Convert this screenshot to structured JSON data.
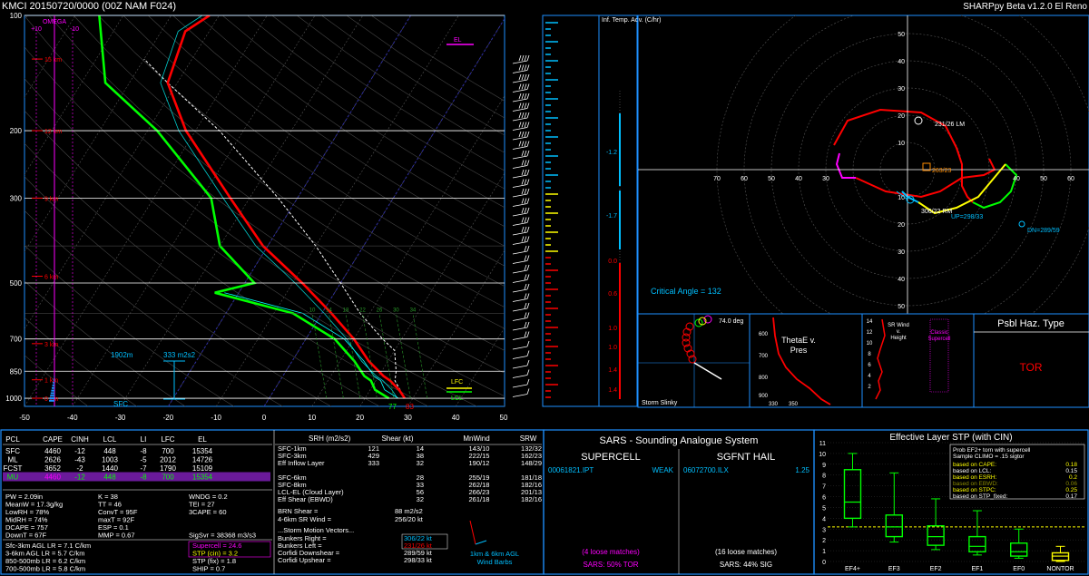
{
  "header": {
    "station_line": "KMCI  20150720/0000  (00Z  NAM  F024)",
    "app_name": "SHARPpy Beta v1.2.0 El Reno"
  },
  "skewt": {
    "pressure_ticks": [
      "100",
      "200",
      "300",
      "500",
      "700",
      "850",
      "1000"
    ],
    "temp_ticks": [
      "-50",
      "-40",
      "-30",
      "-20",
      "-10",
      "0",
      "10",
      "20",
      "30",
      "40",
      "50"
    ],
    "height_labels": [
      "15 km",
      "12 km",
      "9 km",
      "6 km",
      "3 km",
      "1 km",
      "0 km"
    ],
    "omega_label": "OMEGA",
    "omega_ticks": [
      "+10",
      "-10"
    ],
    "el_label": "EL",
    "lfc_label": "LFC",
    "lcl_label": "LCL",
    "sfc_label": "SFC",
    "inflow_depth": "1902m",
    "inflow_srh": "333 m2s2",
    "sfc_td": "77",
    "sfc_t": "83",
    "mixing_ratios": [
      "10",
      "14",
      "18",
      "22",
      "26",
      "30",
      "34"
    ]
  },
  "inferred_temp_adv": {
    "title": "Inf. Temp. Adv. (C/hr)",
    "values": [
      "-1.2",
      "-1.7",
      "0.0",
      "0.6",
      "1.0",
      "1.0",
      "1.4",
      "1.4"
    ]
  },
  "hodograph": {
    "range_labels": [
      "10",
      "20",
      "30",
      "40",
      "50"
    ],
    "x_left_labels": [
      "70",
      "60",
      "50",
      "40",
      "30"
    ],
    "x_right_labels": [
      "40",
      "50",
      "60",
      "70"
    ],
    "bunkers_left": "231/26 LM",
    "bunkers_right": "306/22 RM",
    "mean_wind": "263/23",
    "upshear": "UP=298/33",
    "downshear": "DN=289/59",
    "critical_angle": "Critical Angle = 132"
  },
  "storm_slinky": {
    "title": "Storm Slinky",
    "angle": "74.0 deg"
  },
  "thetae": {
    "title_line1": "ThetaE v.",
    "title_line2": "Pres",
    "p_ticks": [
      "600",
      "700",
      "800",
      "900"
    ],
    "x_ticks": [
      "330",
      "350"
    ]
  },
  "srwind": {
    "title_line1": "SR Wind",
    "title_line2": "v.",
    "title_line3": "Height",
    "annotation_line1": "Classic",
    "annotation_line2": "Supercell",
    "h_ticks": [
      "14",
      "12",
      "10",
      "8",
      "6",
      "4",
      "2"
    ]
  },
  "hazard": {
    "title": "Psbl Haz. Type",
    "value": "TOR"
  },
  "parcels": {
    "headers": [
      "PCL",
      "CAPE",
      "CINH",
      "LCL",
      "LI",
      "LFC",
      "EL"
    ],
    "rows": [
      [
        "SFC",
        "4460",
        "-12",
        "448",
        "-8",
        "700",
        "15354"
      ],
      [
        "ML",
        "2626",
        "-43",
        "1003",
        "-5",
        "2012",
        "14726"
      ],
      [
        "FCST",
        "3652",
        "-2",
        "1440",
        "-7",
        "1790",
        "15109"
      ],
      [
        "MU",
        "4460",
        "-12",
        "448",
        "-8",
        "700",
        "15354"
      ]
    ]
  },
  "thermo": {
    "col1": [
      "PW = 2.09in",
      "MeanW = 17.3g/kg",
      "LowRH = 78%",
      "MidRH = 74%",
      "DCAPE = 757",
      "DownT = 67F"
    ],
    "col2": [
      "K = 38",
      "TT = 46",
      "ConvT = 95F",
      "maxT = 92F",
      "ESP = 0.1",
      "MMP = 0.67"
    ],
    "col3": [
      "WNDG = 0.2",
      "TEI = 27",
      "3CAPE = 60",
      "",
      "",
      "SigSvr = 38368 m3/s3"
    ],
    "lapse": [
      "Sfc-3km AGL LR = 7.1 C/km",
      "3-6km AGL LR = 5.7 C/km",
      "850-500mb LR = 6.2 C/km",
      "700-500mb LR = 5.8 C/km"
    ],
    "composites": [
      "Supercell = 24.6",
      "STP (cin) = 3.2",
      "STP (fix) = 1.8",
      "SHIP = 0.7"
    ]
  },
  "kinematics": {
    "headers": [
      "SRH (m2/s2)",
      "Shear (kt)",
      "MnWind",
      "SRW"
    ],
    "rows": [
      [
        "SFC-1km",
        "121",
        "14",
        "143/10",
        "132/32"
      ],
      [
        "SFC-3km",
        "429",
        "38",
        "222/15",
        "162/23"
      ],
      [
        "Eff Inflow Layer",
        "333",
        "32",
        "190/12",
        "148/29"
      ],
      [
        "",
        "",
        "",
        "",
        ""
      ],
      [
        "SFC-6km",
        "",
        "28",
        "255/19",
        "181/18"
      ],
      [
        "SFC-8km",
        "",
        "33",
        "262/18",
        "182/16"
      ],
      [
        "LCL-EL (Cloud Layer)",
        "",
        "56",
        "266/23",
        "201/13"
      ],
      [
        "Eff Shear (EBWD)",
        "",
        "32",
        "261/18",
        "182/16"
      ]
    ],
    "brn_shear_label": "BRN Shear =",
    "brn_shear_value": "88 m2/s2",
    "sr_wind_label": "4-6km SR Wind =",
    "sr_wind_value": "256/20 kt",
    "motion_header": "...Storm Motion Vectors...",
    "motions": [
      [
        "Bunkers Right =",
        "306/22 kt"
      ],
      [
        "Bunkers Left =",
        "231/26 kt"
      ],
      [
        "Corfidi Downshear =",
        "289/59 kt"
      ],
      [
        "Corfidi Upshear =",
        "298/33 kt"
      ]
    ],
    "barb_label1": "1km & 6km AGL",
    "barb_label2": "Wind Barbs"
  },
  "sars": {
    "title": "SARS - Sounding Analogue System",
    "supercell_header": "SUPERCELL",
    "hail_header": "SGFNT HAIL",
    "supercell_match": "00061821.IPT",
    "supercell_match_strength": "WEAK",
    "hail_match": "06072700.ILX",
    "hail_match_size": "1.25",
    "supercell_loose": "(4 loose matches)",
    "hail_loose": "(16 loose matches)",
    "supercell_pct": "SARS: 50% TOR",
    "hail_pct": "SARS: 44% SIG"
  },
  "stp": {
    "title": "Effective Layer STP (with CIN)",
    "y_ticks": [
      "0",
      "1",
      "2",
      "3",
      "4",
      "5",
      "6",
      "7",
      "8",
      "9",
      "10",
      "11"
    ],
    "legend_title_1": "Prob EF2+ torn with supercell",
    "legend_title_2": "Sample CLIMO = .15 sigtor",
    "legend_rows": [
      [
        "based on CAPE:",
        "0.18"
      ],
      [
        "based on LCL:",
        "0.15"
      ],
      [
        "based on ESRH:",
        "0.2"
      ],
      [
        "based on EBWD:",
        "0.06"
      ],
      [
        "based on STPC:",
        "0.25"
      ],
      [
        "based on STP_fixed:",
        "0.17"
      ]
    ],
    "legend_colors": [
      "#ffff00",
      "#ffffff",
      "#ffff00",
      "#8b8b00",
      "#ffff00",
      "#ffffff"
    ]
  },
  "chart_data": [
    {
      "type": "line",
      "title": "",
      "xlabel": "Temperature (C)",
      "ylabel": "Pressure (mb)",
      "xlim": [
        -50,
        50
      ],
      "ylim": [
        1000,
        100
      ],
      "series": [
        {
          "name": "Temperature",
          "color": "#ff0000",
          "points": [
            [
              28.3,
              1000
            ],
            [
              26,
              950
            ],
            [
              23,
              900
            ],
            [
              21,
              875
            ],
            [
              16,
              800
            ],
            [
              10,
              700
            ],
            [
              2,
              600
            ],
            [
              -8,
              500
            ],
            [
              -21,
              400
            ],
            [
              -34,
              300
            ],
            [
              -52,
              200
            ],
            [
              -62,
              150
            ],
            [
              -65,
              110
            ],
            [
              -62,
              100
            ]
          ]
        },
        {
          "name": "Dewpoint",
          "color": "#00ff00",
          "points": [
            [
              25,
              1000
            ],
            [
              21,
              950
            ],
            [
              19,
              900
            ],
            [
              17,
              875
            ],
            [
              13,
              800
            ],
            [
              6,
              700
            ],
            [
              -6,
              600
            ],
            [
              -25,
              530
            ],
            [
              -18,
              500
            ],
            [
              -30,
              400
            ],
            [
              -38,
              300
            ],
            [
              -58,
              200
            ],
            [
              -75,
              150
            ],
            [
              -85,
              100
            ]
          ]
        }
      ]
    },
    {
      "type": "bar",
      "title": "Effective Layer STP (with CIN)",
      "categories": [
        "EF4+",
        "EF3",
        "EF2",
        "EF1",
        "EF0",
        "NONTOR"
      ],
      "box_low": [
        3.2,
        1.8,
        1.1,
        0.6,
        0.3,
        0
      ],
      "q1": [
        4.0,
        2.3,
        1.5,
        0.9,
        0.5,
        0.1
      ],
      "median": [
        5.5,
        3.2,
        2.3,
        1.4,
        0.9,
        0.5
      ],
      "q3": [
        8.5,
        4.3,
        3.3,
        2.3,
        1.7,
        0.8
      ],
      "box_high": [
        10.0,
        8.2,
        5.8,
        4.7,
        3.0,
        1.4
      ],
      "ylim": [
        0,
        11
      ],
      "current_value": 3.2
    }
  ],
  "colors": {
    "temp": "#ff0000",
    "dewp": "#00ff00",
    "accent": "#00bfff",
    "frame": "#1e90ff",
    "magenta": "#ff00ff"
  }
}
